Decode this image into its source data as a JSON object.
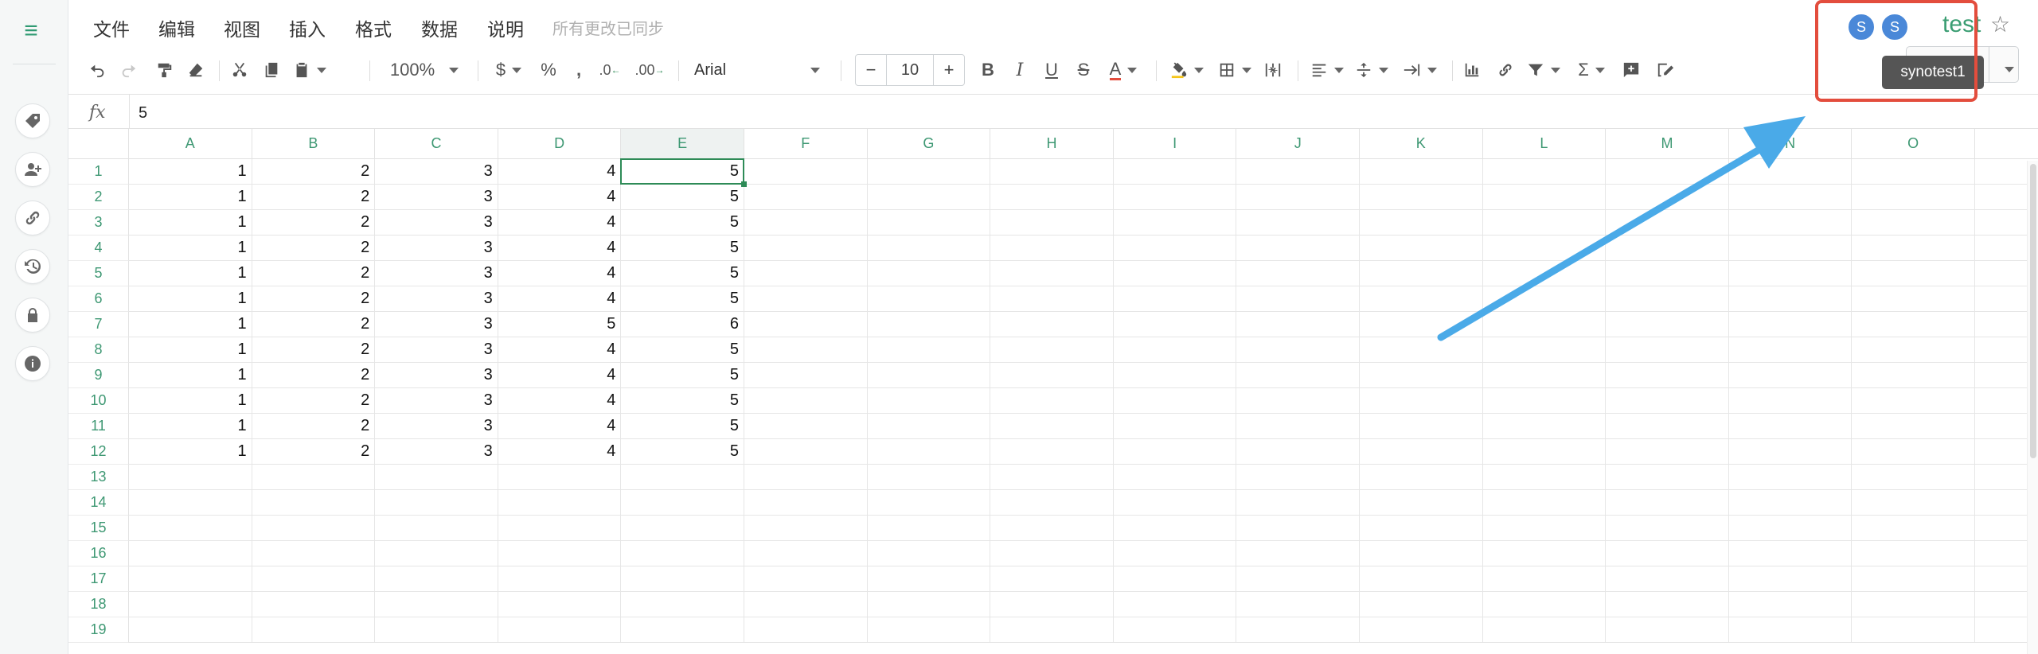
{
  "menu": {
    "items": [
      "文件",
      "编辑",
      "视图",
      "插入",
      "格式",
      "数据",
      "说明"
    ],
    "sync_status": "所有更改已同步"
  },
  "toolbar": {
    "zoom": "100%",
    "currency": "$",
    "percent": "%",
    "comma": ",",
    "decimal_decrease": ".0",
    "decimal_increase": ".00",
    "font_name": "Arial",
    "font_size": "10",
    "font_minus": "−",
    "font_plus": "+",
    "bold": "B",
    "italic": "I",
    "underline": "U",
    "strike": "S",
    "text_color": "A",
    "sum": "Σ"
  },
  "formula": {
    "label": "fx",
    "value": "5"
  },
  "grid": {
    "columns": [
      "A",
      "B",
      "C",
      "D",
      "E",
      "F",
      "G",
      "H",
      "I",
      "J",
      "K",
      "L",
      "M",
      "N",
      "O"
    ],
    "row_labels": [
      "1",
      "2",
      "3",
      "4",
      "5",
      "6",
      "7",
      "8",
      "9",
      "10",
      "11",
      "12",
      "13",
      "14",
      "15",
      "16",
      "17",
      "18",
      "19"
    ],
    "rows": [
      [
        "1",
        "2",
        "3",
        "4",
        "5"
      ],
      [
        "1",
        "2",
        "3",
        "4",
        "5"
      ],
      [
        "1",
        "2",
        "3",
        "4",
        "5"
      ],
      [
        "1",
        "2",
        "3",
        "4",
        "5"
      ],
      [
        "1",
        "2",
        "3",
        "4",
        "5"
      ],
      [
        "1",
        "2",
        "3",
        "4",
        "5"
      ],
      [
        "1",
        "2",
        "3",
        "5",
        "6"
      ],
      [
        "1",
        "2",
        "3",
        "4",
        "5"
      ],
      [
        "1",
        "2",
        "3",
        "4",
        "5"
      ],
      [
        "1",
        "2",
        "3",
        "4",
        "5"
      ],
      [
        "1",
        "2",
        "3",
        "4",
        "5"
      ],
      [
        "1",
        "2",
        "3",
        "4",
        "5"
      ]
    ],
    "selected_cell": "E1"
  },
  "collaborators": {
    "avatars": [
      "S",
      "S"
    ],
    "tooltip": "synotest1",
    "avatar_color": "#4a88d8"
  },
  "document": {
    "title": "test",
    "star": "☆"
  },
  "colors": {
    "accent": "#2e8b57",
    "highlight": "#e34d3d",
    "arrow": "#4aaae8"
  }
}
